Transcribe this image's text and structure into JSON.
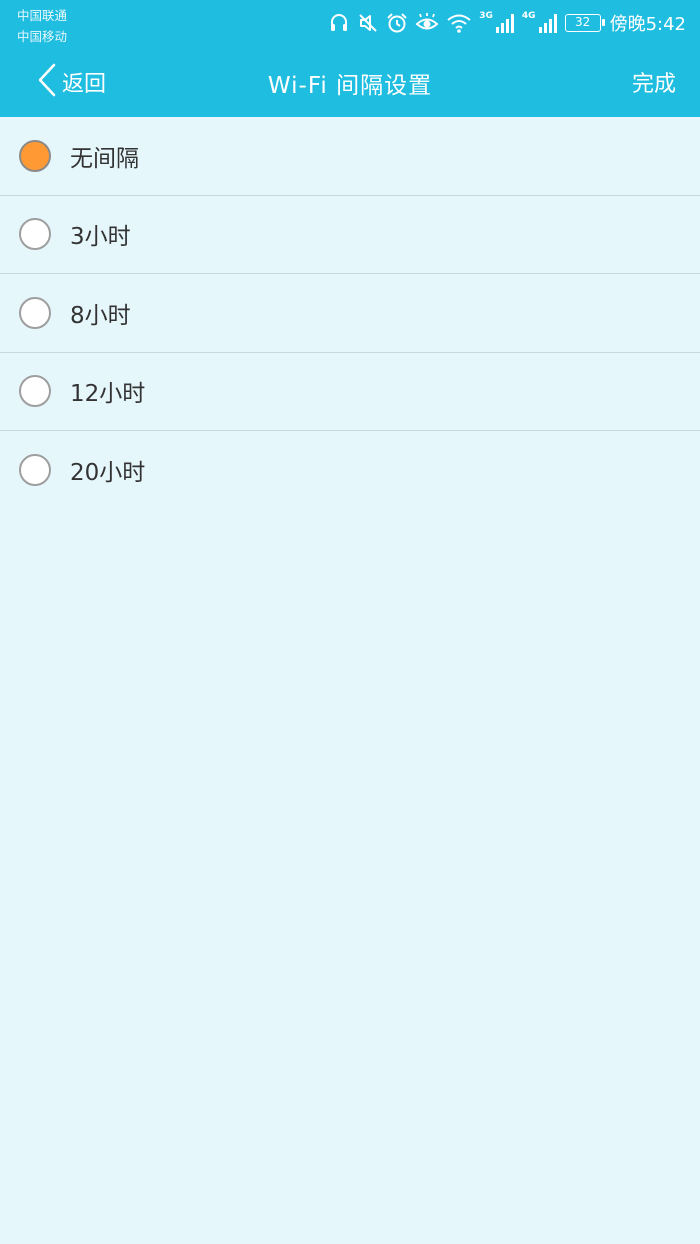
{
  "status_bar": {
    "carrier_1": "中国联通",
    "carrier_2": "中国移动",
    "network_3g": "3G",
    "network_4g": "4G",
    "battery": "32",
    "time": "傍晚5:42",
    "icons": [
      "headset-icon",
      "mute-icon",
      "alarm-icon",
      "eye-comfort-icon",
      "wifi-icon",
      "signal-3g-icon",
      "signal-4g-icon",
      "battery-icon"
    ]
  },
  "nav": {
    "back_label": "返回",
    "title": "Wi-Fi 间隔设置",
    "done_label": "完成"
  },
  "options": [
    {
      "label": "无间隔",
      "selected": true
    },
    {
      "label": "3小时",
      "selected": false
    },
    {
      "label": "8小时",
      "selected": false
    },
    {
      "label": "12小时",
      "selected": false
    },
    {
      "label": "20小时",
      "selected": false
    }
  ],
  "colors": {
    "header": "#1fbde0",
    "background": "#e6f7fc",
    "selected_radio": "#ff9933"
  }
}
